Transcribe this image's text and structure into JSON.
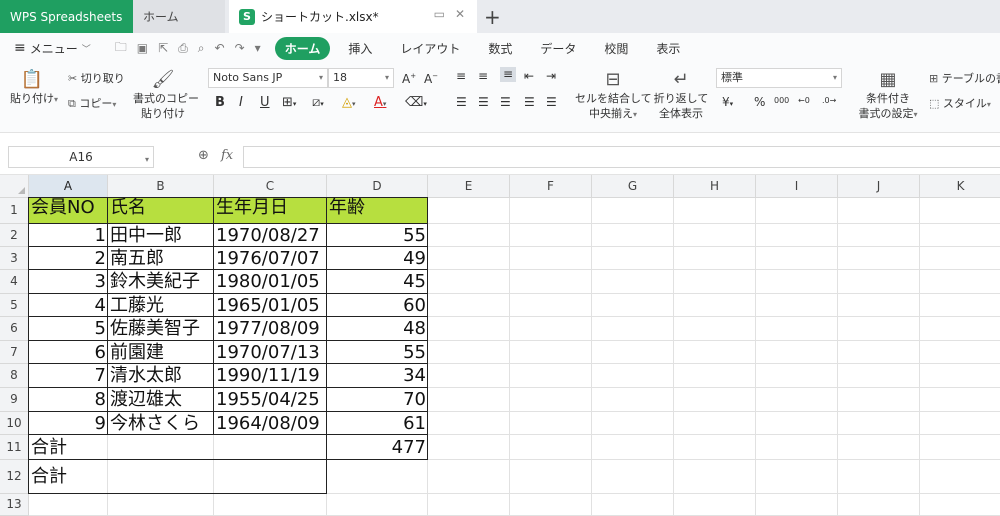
{
  "tabs": {
    "app": "WPS Spreadsheets",
    "home": "ホーム",
    "file_badge": "S",
    "file": "ショートカット.xlsx*"
  },
  "menu": {
    "label": "メニュー",
    "ribbon_tabs": [
      "ホーム",
      "挿入",
      "レイアウト",
      "数式",
      "データ",
      "校閲",
      "表示"
    ],
    "active_tab": "ホーム"
  },
  "toolbar": {
    "paste": "貼り付け",
    "cut": "切り取り",
    "copy": "コピー",
    "format_copy_1": "書式のコピー",
    "format_copy_2": "貼り付け",
    "font_name": "Noto Sans JP",
    "font_size": "18",
    "merge_1": "セルを結合して",
    "merge_2": "中央揃え",
    "wrap_1": "折り返して",
    "wrap_2": "全体表示",
    "number_format": "標準",
    "cond_1": "条件付き",
    "cond_2": "書式の設定",
    "table_style": "テーブルの書",
    "style": "スタイル"
  },
  "formula_bar": {
    "name_box": "A16",
    "fx_label": "fx",
    "formula": ""
  },
  "sheet": {
    "columns": [
      "A",
      "B",
      "C",
      "D",
      "E",
      "F",
      "G",
      "H",
      "I",
      "J",
      "K"
    ],
    "rows": [
      "1",
      "2",
      "3",
      "4",
      "5",
      "6",
      "7",
      "8",
      "9",
      "10",
      "11",
      "12",
      "13"
    ],
    "header": [
      "会員NO",
      "氏名",
      "生年月日",
      "年齢"
    ],
    "data": [
      [
        "1",
        "田中一郎",
        "1970/08/27",
        "55"
      ],
      [
        "2",
        "南五郎",
        "1976/07/07",
        "49"
      ],
      [
        "3",
        "鈴木美紀子",
        "1980/01/05",
        "45"
      ],
      [
        "4",
        "工藤光",
        "1965/01/05",
        "60"
      ],
      [
        "5",
        "佐藤美智子",
        "1977/08/09",
        "48"
      ],
      [
        "6",
        "前園建",
        "1970/07/13",
        "55"
      ],
      [
        "7",
        "清水太郎",
        "1990/11/19",
        "34"
      ],
      [
        "8",
        "渡辺雄太",
        "1955/04/25",
        "70"
      ],
      [
        "9",
        "今林さくら",
        "1964/08/09",
        "61"
      ]
    ],
    "total_label_11": "合計",
    "total_value_11": "477",
    "total_label_12": "合計",
    "header_fill": "#b7df3f",
    "accent": "#1f9f61"
  }
}
